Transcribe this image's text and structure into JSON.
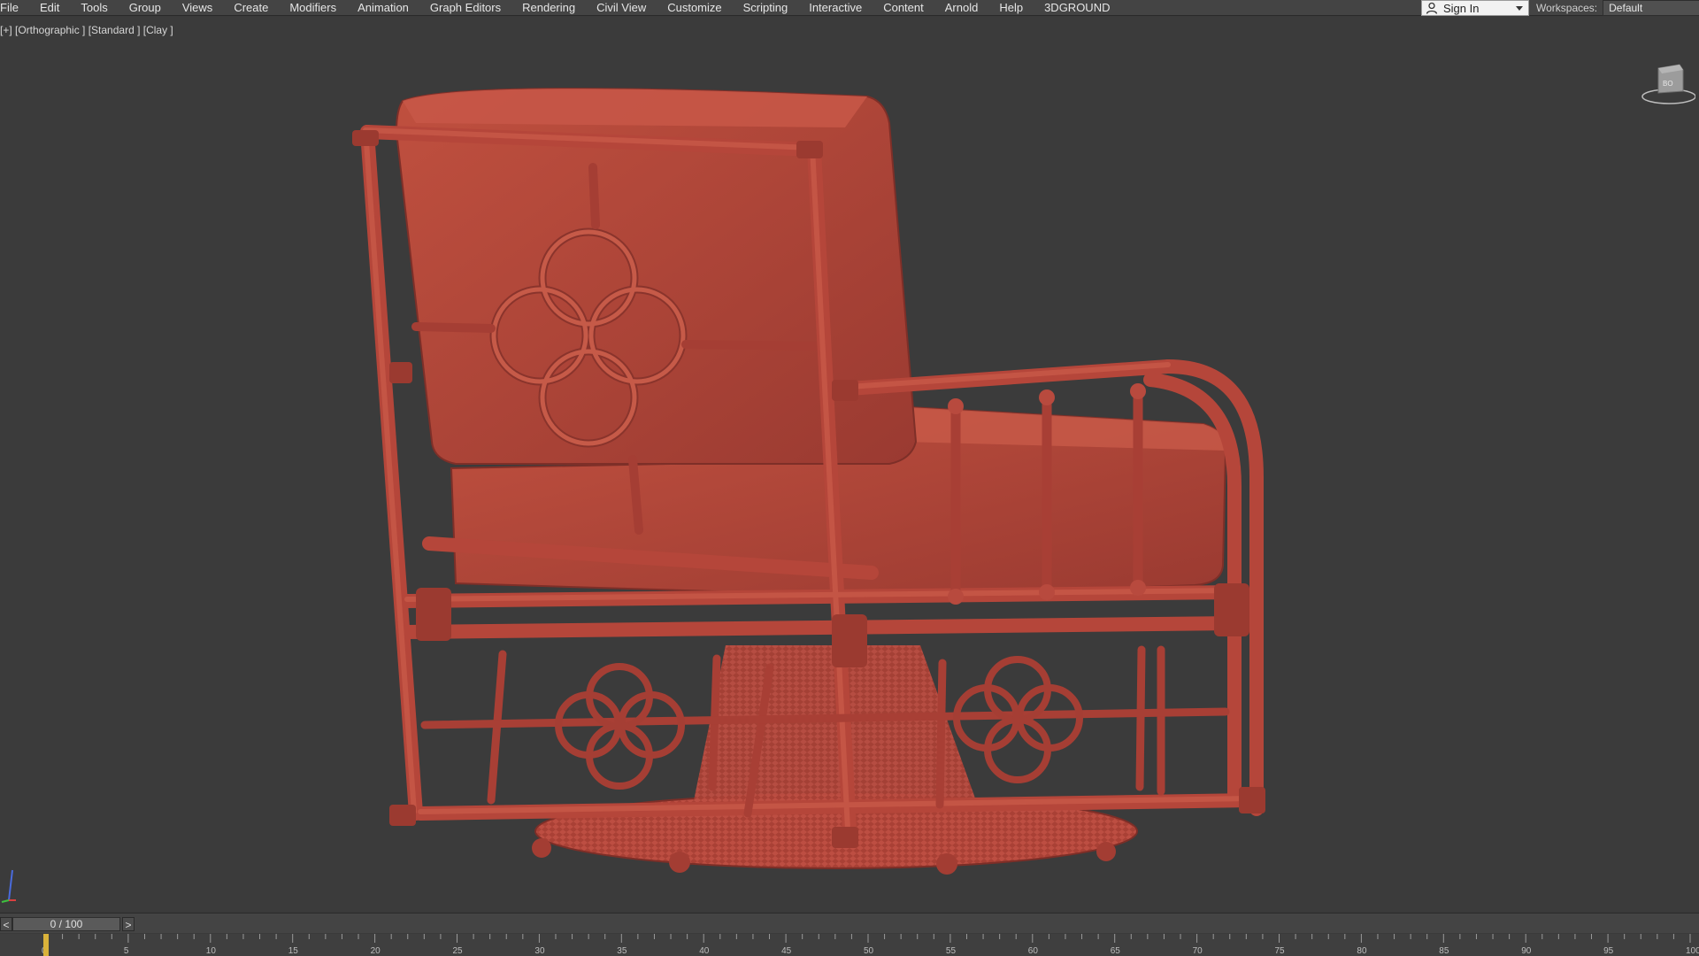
{
  "menubar": {
    "items": [
      "File",
      "Edit",
      "Tools",
      "Group",
      "Views",
      "Create",
      "Modifiers",
      "Animation",
      "Graph Editors",
      "Rendering",
      "Civil View",
      "Customize",
      "Scripting",
      "Interactive",
      "Content",
      "Arnold",
      "Help",
      "3DGROUND"
    ],
    "signin_label": "Sign In",
    "workspaces_label": "Workspaces:",
    "workspace_value": "Default"
  },
  "viewport": {
    "label": "[+] [Orthographic ] [Standard ] [Clay ]",
    "viewcube_text": "BO",
    "model_color": "#b8473c",
    "background": "#3b3b3b"
  },
  "timeline": {
    "frame_display": "0 / 100",
    "prev_label": "<",
    "next_label": ">",
    "ticks": [
      0,
      5,
      10,
      15,
      20,
      25,
      30,
      35,
      40,
      45,
      50,
      55,
      60,
      65,
      70,
      75,
      80,
      85,
      90,
      95,
      100
    ]
  }
}
